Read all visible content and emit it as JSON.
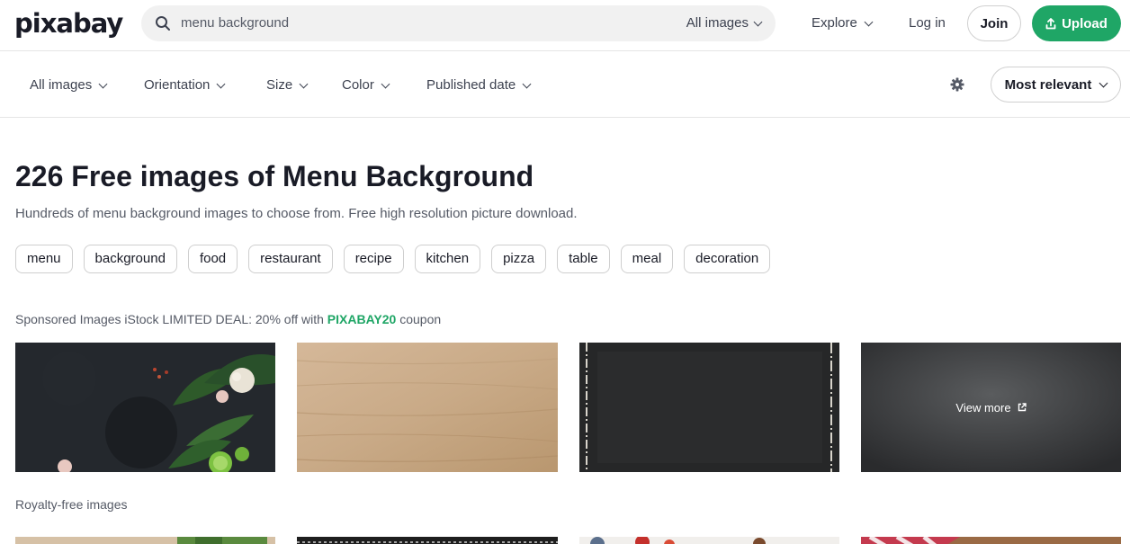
{
  "header": {
    "logo": "pixabay",
    "search_value": "menu background",
    "search_type": "All images",
    "explore": "Explore",
    "login": "Log in",
    "join": "Join",
    "upload": "Upload",
    "accent_color": "#1fa666"
  },
  "filters": {
    "items": [
      "All images",
      "Orientation",
      "Size",
      "Color",
      "Published date"
    ],
    "sort": "Most relevant"
  },
  "main": {
    "heading": "226 Free images of Menu Background",
    "subtitle": "Hundreds of menu background images to choose from. Free high resolution picture download.",
    "tags": [
      "menu",
      "background",
      "food",
      "restaurant",
      "recipe",
      "kitchen",
      "pizza",
      "table",
      "meal",
      "decoration"
    ],
    "sponsored_prefix": "Sponsored Images iStock LIMITED DEAL: 20% off with ",
    "sponsored_code": "PIXABAY20",
    "sponsored_suffix": " coupon",
    "view_more": "View more",
    "royalty_free": "Royalty-free images"
  }
}
